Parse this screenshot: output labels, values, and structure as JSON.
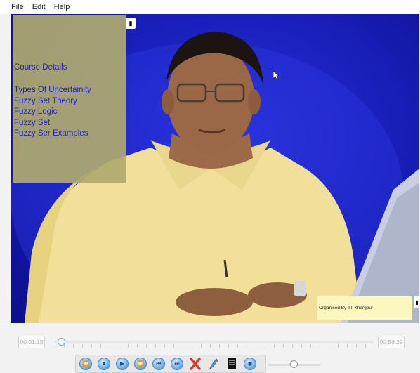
{
  "menu": {
    "items": [
      "File",
      "Edit",
      "Help"
    ]
  },
  "course": {
    "title": "Course Details",
    "topics": [
      "Types Of Uncertainity",
      "Fuzzy Set Theory",
      "Fuzzy Logic",
      "Fuzzy Set",
      "Fuzzy Ser Examples"
    ]
  },
  "organiser": "Organised By IIT Khargpur",
  "player": {
    "current_time": "00:01:15",
    "total_time": "00:56:29",
    "progress": 0.022,
    "volume": 0.5
  },
  "controls": {
    "icons": [
      "rewind-icon",
      "stop-icon",
      "play-icon",
      "fast-forward-icon",
      "previous-icon",
      "next-icon",
      "close-icon",
      "pen-icon",
      "notes-icon",
      "screenshot-icon"
    ]
  },
  "colors": {
    "overlay_text": "#1d1dd6",
    "video_bg": "#1a20bd",
    "accent": "#4a86c4"
  }
}
